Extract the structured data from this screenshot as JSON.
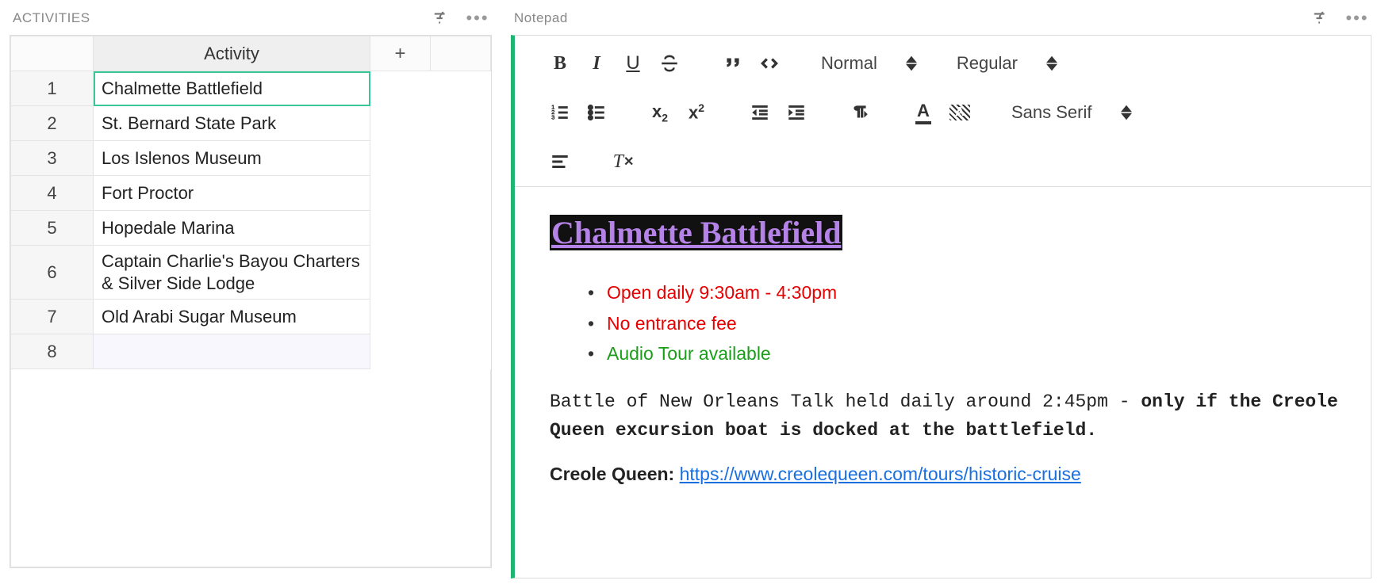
{
  "left": {
    "title": "ACTIVITIES",
    "column_header": "Activity",
    "add_col": "+",
    "rows": [
      {
        "n": "1",
        "v": "Chalmette Battlefield",
        "selected": true
      },
      {
        "n": "2",
        "v": "St. Bernard State Park"
      },
      {
        "n": "3",
        "v": "Los Islenos Museum"
      },
      {
        "n": "4",
        "v": "Fort Proctor"
      },
      {
        "n": "5",
        "v": "Hopedale Marina"
      },
      {
        "n": "6",
        "v": "Captain Charlie's Bayou Charters & Silver Side Lodge"
      },
      {
        "n": "7",
        "v": "Old Arabi Sugar Museum"
      },
      {
        "n": "8",
        "v": "",
        "empty": true
      }
    ]
  },
  "right": {
    "title": "Notepad",
    "selects": {
      "heading": "Normal",
      "weight": "Regular",
      "font": "Sans Serif"
    },
    "note": {
      "heading": "Chalmette Battlefield",
      "bullets": [
        {
          "text": "Open daily 9:30am - 4:30pm",
          "cls": "red"
        },
        {
          "text": "No entrance fee",
          "cls": "red"
        },
        {
          "text": "Audio Tour available",
          "cls": "green"
        }
      ],
      "talk_plain": "Battle of New Orleans Talk held daily around 2:45pm",
      "talk_dash": " - ",
      "talk_bold": "only if the Creole Queen excursion boat is docked at the battlefield.",
      "cq_label": "Creole Queen: ",
      "cq_link": "https://www.creolequeen.com/tours/historic-cruise"
    }
  }
}
